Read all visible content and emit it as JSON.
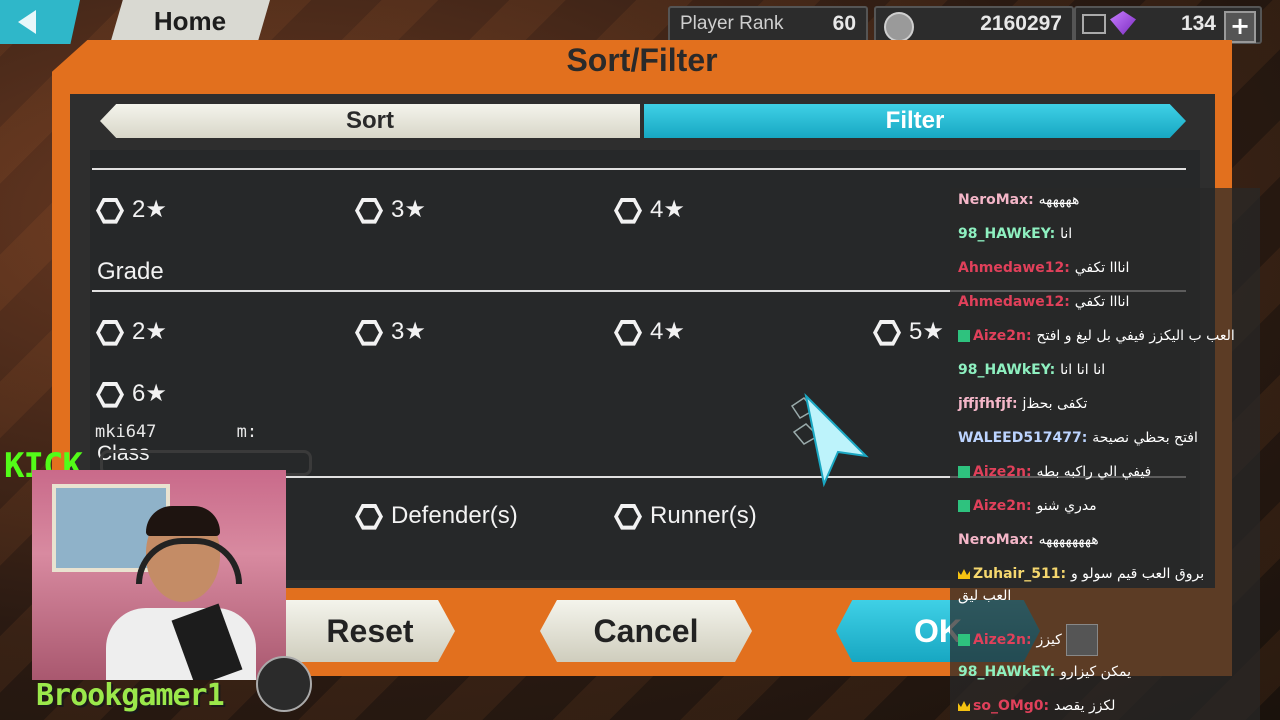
{
  "topbar": {
    "home_label": "Home",
    "rank_label": "Player Rank",
    "rank_value": "60",
    "coins_value": "2160297",
    "gems_value": "134",
    "plus_label": "+"
  },
  "dialog": {
    "title": "Sort/Filter",
    "tabs": {
      "sort": "Sort",
      "filter": "Filter"
    },
    "rarity_options": [
      "2★",
      "3★",
      "4★"
    ],
    "grade_label": "Grade",
    "grade_options": [
      "2★",
      "3★",
      "4★",
      "5★",
      "6★"
    ],
    "partial_row": "mki647",
    "partial_row2": "m:",
    "class_label": "Class",
    "class_options": [
      "Defender(s)",
      "Runner(s)"
    ],
    "buttons": {
      "reset": "Reset",
      "cancel": "Cancel",
      "ok": "OK"
    }
  },
  "chat": {
    "messages": [
      {
        "user": "NeroMax",
        "color": "#f4b6c8",
        "text": "هههههه"
      },
      {
        "user": "98_HAWkEY",
        "color": "#8ef0c0",
        "text": "انا"
      },
      {
        "user": "Ahmedawe12",
        "color": "#e0405a",
        "text": "انااا تكفي"
      },
      {
        "user": "Ahmedawe12",
        "color": "#e0405a",
        "text": "انااا تكفي"
      },
      {
        "user": "Aize2n",
        "color": "#e0405a",
        "text": "العب ب اليكزز فيفي بل ليغ و افتح",
        "badge": true
      },
      {
        "user": "98_HAWkEY",
        "color": "#8ef0c0",
        "text": "انا انا انا"
      },
      {
        "user": "jffjfhfjf",
        "color": "#f4b6c8",
        "text": "jتكفى بحظ"
      },
      {
        "user": "WALEED517477",
        "color": "#bcd4ff",
        "text": "افتح بحظي نصيحة"
      },
      {
        "user": "Aize2n",
        "color": "#e0405a",
        "text": "فيفي الي راكبه بطه",
        "badge": true
      },
      {
        "user": "Aize2n",
        "color": "#e0405a",
        "text": "مدري شنو",
        "badge": true
      },
      {
        "user": "NeroMax",
        "color": "#f4b6c8",
        "text": "ههههههههه"
      },
      {
        "user": "Zuhair_511",
        "color": "#f5d76e",
        "text": "بروق العب قيم سولو و",
        "crown": true
      },
      {
        "user": "",
        "color": "#ffffff",
        "text": "العب ليق"
      },
      {
        "user": "Aize2n",
        "color": "#e0405a",
        "text": "كيزز",
        "badge": true,
        "avatar": true
      },
      {
        "user": "98_HAWkEY",
        "color": "#8ef0c0",
        "text": "يمكن كيزارو"
      },
      {
        "user": "so_OMg0",
        "color": "#e0405a",
        "text": "لكزز يقصد",
        "crown": true
      }
    ]
  },
  "stream": {
    "platform": "KICK",
    "streamer": "Brookgamer1"
  }
}
